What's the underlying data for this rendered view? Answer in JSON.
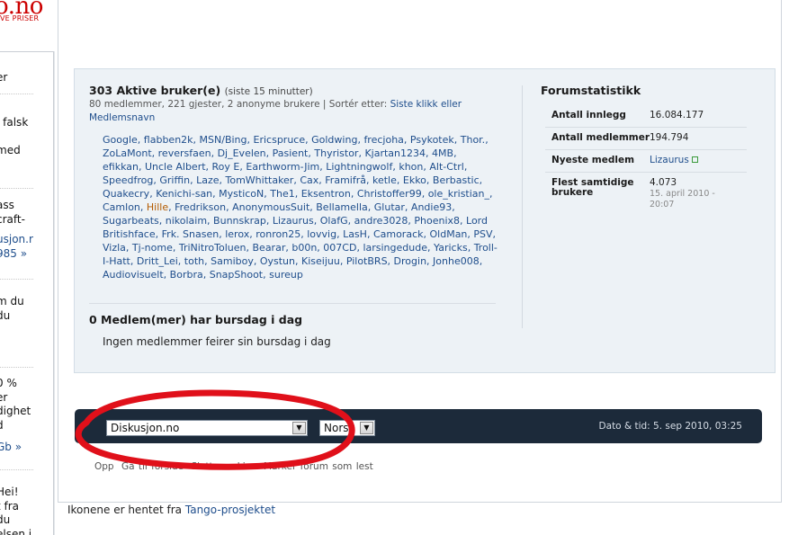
{
  "sidebar": {
    "logo": "o.no",
    "tagline": "VE PRISER",
    "title": "er",
    "blocks": [
      {
        "lines": [
          "l falsk",
          "i",
          "med"
        ]
      },
      {
        "lines": [
          "ass",
          "craft-"
        ],
        "link_lines": [
          "usjon.r",
          "985 »"
        ]
      },
      {
        "lines": [
          "m du",
          "du"
        ]
      },
      {
        "lines": [
          "0 %",
          "er",
          "dighet",
          "d"
        ],
        "link_lines": [
          "Gb »"
        ]
      },
      {
        "lines": [
          "Hei!",
          "t fra",
          "du",
          "elsen i"
        ]
      }
    ]
  },
  "whos_online": {
    "heading": "303 Aktive bruker(e)",
    "heading_suffix": "(siste 15 minutter)",
    "summary": "80 medlemmer, 221 gjester, 2 anonyme brukere | Sortér etter:",
    "sort_links": "Siste klikk eller Medlemsnavn",
    "users": [
      "Google",
      "flabben2k",
      "MSN/Bing",
      "Ericspruce",
      "Goldwing",
      "frecjoha",
      "Psykotek",
      "Thor.",
      "ZoLaMont",
      "reversfaen",
      "Dj_Evelen",
      "Pasient",
      "Thyristor",
      "Kjartan1234",
      "4MB",
      "efikkan",
      "Uncle Albert",
      "Roy E",
      "Earthworm-Jim",
      "Lightningwolf",
      "khon",
      "Alt-Ctrl",
      "Speedfrog",
      "Griffin",
      "Laze",
      "TomWhittaker",
      "Cax",
      "Framifrå",
      "ketle",
      "Ekko",
      "Berbastic",
      "Quakecry",
      "Kenichi-san",
      "MysticoN",
      "The1",
      "Eksentron",
      "Christoffer99",
      "ole_kristian_",
      "Camlon",
      "Hille",
      "Fredrikson",
      "AnonymousSuit",
      "Bellamella",
      "Glutar",
      "Andie93",
      "Sugarbeats",
      "nikolaim",
      "Bunnskrap",
      "Lizaurus",
      "OlafG",
      "andre3028",
      "Phoenix8",
      "Lord Britishface",
      "Frk. Snasen",
      "lerox",
      "ronron25",
      "lovvig",
      "LasH",
      "Camorack",
      "OldMan",
      "PSV",
      "Vizla",
      "Tj-nome",
      "TriNitroToluen",
      "Bearar",
      "b00n",
      "007CD",
      "larsingedude",
      "Yaricks",
      "Troll-I-Hatt",
      "Dritt_Lei",
      "toth",
      "Samiboy",
      "Oystun",
      "Kiseijuu",
      "PilotBRS",
      "Drogin",
      "Jonhe008",
      "Audiovisuelt",
      "Borbra",
      "SnapShoot",
      "sureup"
    ],
    "highlight_user": "Hille",
    "birthday_heading": "0 Medlem(mer) har bursdag i dag",
    "birthday_text": "Ingen medlemmer feirer sin bursdag i dag"
  },
  "stats": {
    "heading": "Forumstatistikk",
    "rows": [
      {
        "label": "Antall innlegg",
        "value": "16.084.177"
      },
      {
        "label": "Antall medlemmer",
        "value": "194.794"
      },
      {
        "label": "Nyeste medlem",
        "value": "Lizaurus"
      },
      {
        "label": "Flest samtidige brukere",
        "value": "4.073",
        "sub": "15. april 2010 - 20:07"
      }
    ]
  },
  "footer": {
    "forum_select": "Diskusjon.no",
    "language_select": "Norsk",
    "datetime": "Dato & tid: 5. sep 2010, 03:25",
    "links": [
      "Opp",
      "Gå til forside",
      "Slett",
      "cookies",
      "Markér forum som lest"
    ]
  },
  "credit": {
    "prefix": "Ikonene er hentet fra",
    "link": "Tango-prosjektet"
  },
  "colors": {
    "link": "#1f4e8c",
    "footer_bar": "#1c2a3a",
    "panel_bg": "#edf2f6",
    "annotation": "#e0101a",
    "logo": "#cc0000"
  }
}
